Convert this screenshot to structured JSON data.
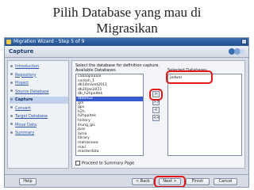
{
  "slide": {
    "title_line1": "Pilih Database yang mau di",
    "title_line2": "Migrasikan"
  },
  "window": {
    "title": "Migration Wizard - Step 5 of 9"
  },
  "header": {
    "step_title": "Capture"
  },
  "sidebar": {
    "items": [
      {
        "label": "Introduction"
      },
      {
        "label": "Repository"
      },
      {
        "label": "Project"
      },
      {
        "label": "Source Database"
      },
      {
        "label": "Capture"
      },
      {
        "label": "Convert"
      },
      {
        "label": "Target Database"
      },
      {
        "label": "Move Data"
      },
      {
        "label": "Summary"
      }
    ]
  },
  "content": {
    "instruction": "Select the database for definition capture.",
    "available_label": "Available Databases",
    "selected_label": "Selected Databases",
    "available": [
      "cobaapaaaal",
      "contoh_1",
      "db14maret2011",
      "db20jan2011",
      "db_h2hpoltek",
      "dbbmu2",
      "gm",
      "gps",
      "h2h",
      "h2hpoltek",
      "history",
      "ihung_gis",
      "ipos",
      "lama",
      "library",
      "mahasiswa",
      "mail",
      "masterdata"
    ],
    "selected_index": 5,
    "selected": [
      "jadwal"
    ],
    "move_buttons": [
      ">",
      ">>",
      "<",
      "<<"
    ],
    "proceed_label": "Proceed to Summary Page"
  },
  "buttons": {
    "help": "Help",
    "back": "< Back",
    "next": "Next >",
    "finish": "Finish",
    "cancel": "Cancel"
  },
  "colors": {
    "highlight": "#e01818",
    "selection": "#3a5bd0"
  }
}
